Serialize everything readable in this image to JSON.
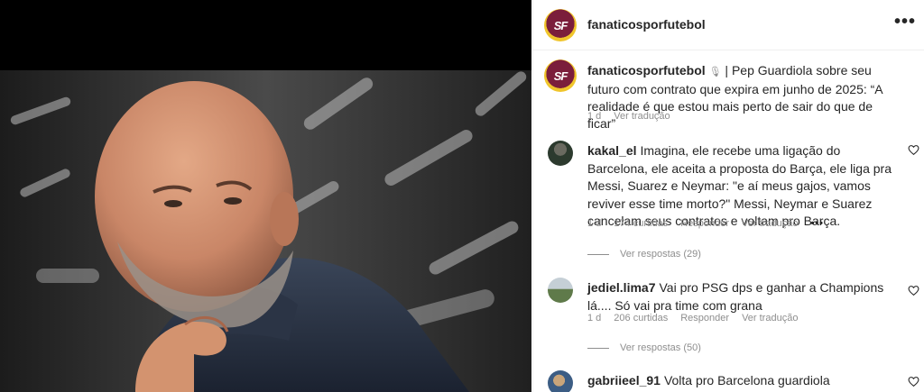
{
  "post": {
    "username": "fanaticosporfutebol",
    "avatar_text": "SF",
    "more_icon": "•••",
    "caption": {
      "username": "fanaticosporfutebol",
      "mic_icon": "🎙",
      "text": " | Pep Guardiola sobre seu futuro com contrato que expira em junho de 2025: “A realidade é que estou mais perto de sair do que de ficar”",
      "time": "1 d",
      "translate": "Ver tradução"
    }
  },
  "comments": [
    {
      "username": "kakal_el",
      "text": "Imagina, ele recebe uma ligação do Barcelona, ele aceita a proposta do Barça, ele liga pra Messi, Suarez e Neymar: \"e aí meus gajos, vamos reviver esse time morto?\" Messi, Neymar e Suarez cancelam seus contratos e voltam pro Barça.",
      "time": "1 d",
      "likes": "174 curtidas",
      "reply": "Responder",
      "translate": "Ver tradução",
      "options": "•••",
      "replies": "Ver respostas (29)"
    },
    {
      "username": "jediel.lima7",
      "text": "Vai pro PSG dps e ganhar a Champions lá.... Só vai pra time com grana",
      "time": "1 d",
      "likes": "206 curtidas",
      "reply": "Responder",
      "translate": "Ver tradução",
      "replies": "Ver respostas (50)"
    },
    {
      "username": "gabriieel_91",
      "text": "Volta pro Barcelona guardiola"
    }
  ],
  "colors": {
    "accent_burgundy": "#7b1e3b",
    "accent_gold": "#f0c52b",
    "muted_text": "#8e8e8e"
  },
  "icons": {
    "more": "more-options-icon",
    "heart": "heart-outline-icon",
    "mic": "microphone-icon"
  }
}
